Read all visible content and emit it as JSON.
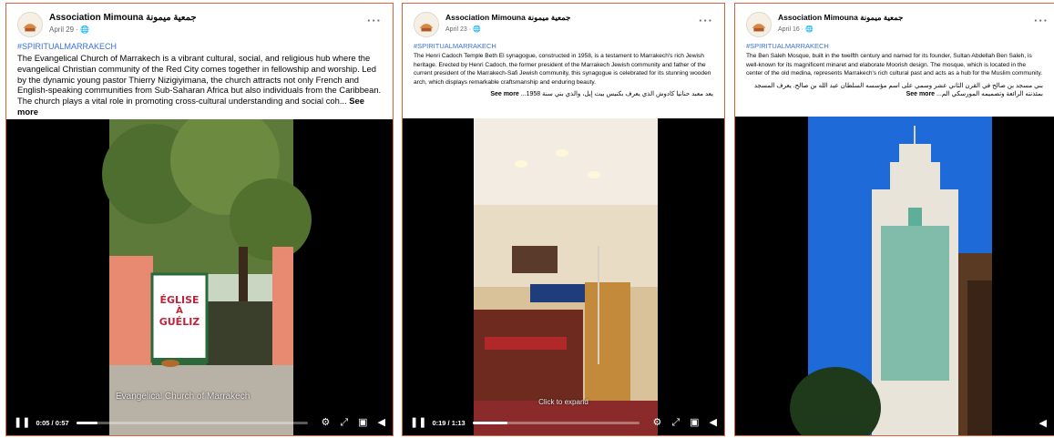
{
  "posts": [
    {
      "page_name": "Association Mimouna جمعية ميمونة",
      "date": "April 29 · 🌐",
      "more_icon": "more-horizontal-icon",
      "hashtag": "#SPIRITUALMARRAKECH",
      "body": "The Evangelical Church of Marrakech is a vibrant cultural, social, and religious hub where the evangelical Christian community of the Red City comes together in fellowship and worship. Led by the dynamic young pastor Thierry Nizigiyimana, the church attracts not only French and English-speaking communities from Sub-Saharan Africa but also individuals from the Caribbean. The church plays a vital role in promoting cross-cultural understanding and social coh... ",
      "see_more": "See more",
      "video": {
        "timecode": "0:05 / 0:57",
        "progress": 0.09,
        "sign_line1": "ÉGLISE",
        "sign_line2": "À",
        "sign_line3": "GUÉLIZ",
        "caption": "Evangelical Church of Marrakech"
      }
    },
    {
      "page_name": "Association Mimouna جمعية ميمونة",
      "date": "April 23 · 🌐",
      "more_icon": "more-horizontal-icon",
      "hashtag": "#SPIRITUALMARRAKECH",
      "body": "The Henri Cadoch Temple Beth El synagogue, constructed in 1958, is a testament to Marrakech's rich Jewish heritage. Erected by Henri Cadoch, the former president of the Marrakech Jewish community and father of the current president of the Marrakech-Safi Jewish community, this synagogue is celebrated for its stunning wooden arch, which displays remarkable craftsmanship and enduring beauty.",
      "arabic": "يعد معبد حنانيا كادوش الذي يعرف بكنيس بيت إيل، والذي بني سنة 1958... ",
      "see_more": "See more",
      "video": {
        "timecode": "0:19 / 1:13",
        "progress": 0.21,
        "expand_hint": "Click to expand"
      }
    },
    {
      "page_name": "Association Mimouna جمعية ميمونة",
      "date": "April 16 · 🌐",
      "more_icon": "more-horizontal-icon",
      "hashtag": "#SPIRITUALMARRAKECH",
      "body": "The Ben Saleh Mosque, built in the twelfth century and named for its founder, Sultan Abdellah Ben Saleh, is well-known for its magnificent minaret and elaborate Moorish design. The mosque, which is located in the center of the old medina, represents Marrakech's rich cultural past and acts as a hub for the Muslim community.",
      "arabic": "بني مسجد بن صالح في القرن الثاني عشر وسمي على اسم مؤسسه السلطان عبد الله بن صالح. يعرف المسجد بمئذنته الرائعة وتصميمه المورسكي الم... ",
      "see_more": "See more",
      "video": {}
    }
  ],
  "colors": {
    "border": "#d9623f",
    "hashtag": "#3b6fd4",
    "meta": "#65676b"
  }
}
